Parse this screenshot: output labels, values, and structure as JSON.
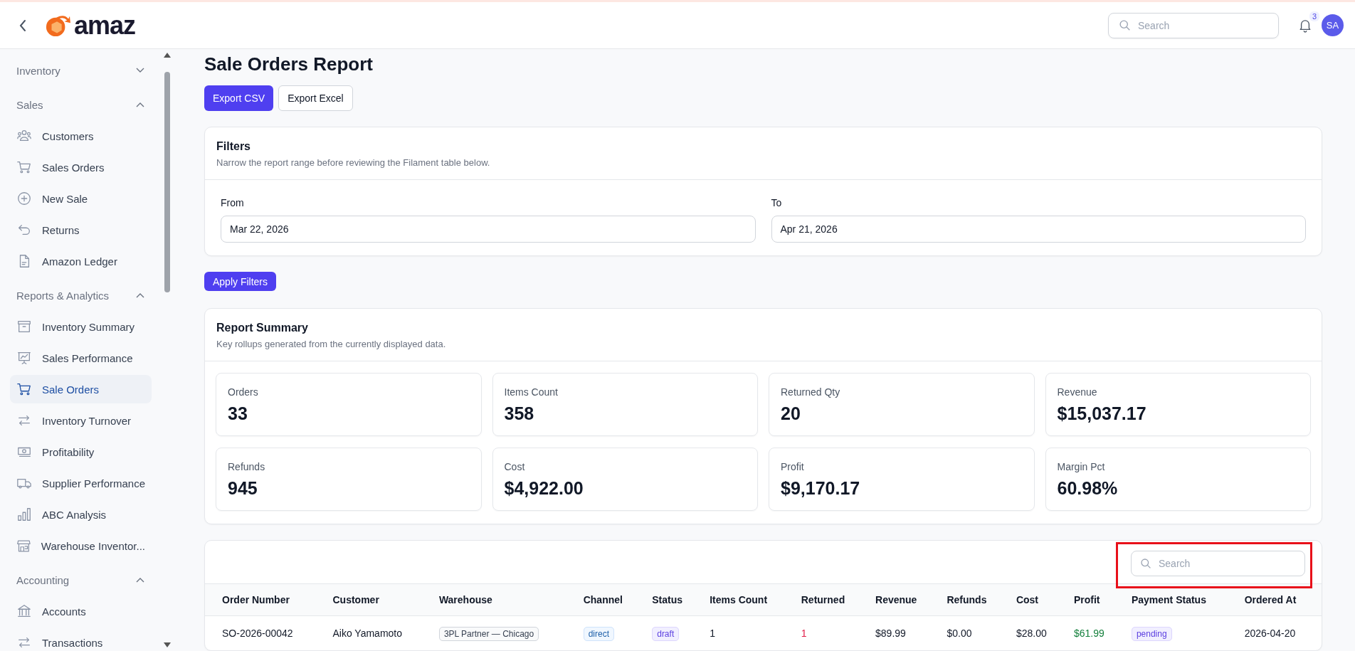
{
  "header": {
    "logo": "amaz",
    "search": {
      "placeholder": "Search"
    },
    "notifications": "3",
    "avatar": "SA"
  },
  "sidebar": {
    "sections": [
      {
        "label": "Inventory",
        "expanded": false
      },
      {
        "label": "Sales",
        "expanded": true,
        "items": [
          {
            "label": "Customers",
            "selected": false
          },
          {
            "label": "Sales Orders",
            "selected": false
          },
          {
            "label": "New Sale",
            "selected": false
          },
          {
            "label": "Returns",
            "selected": false
          },
          {
            "label": "Amazon Ledger",
            "selected": false
          }
        ]
      },
      {
        "label": "Reports & Analytics",
        "expanded": true,
        "items": [
          {
            "label": "Inventory Summary",
            "selected": false
          },
          {
            "label": "Sales Performance",
            "selected": false
          },
          {
            "label": "Sale Orders",
            "selected": true
          },
          {
            "label": "Inventory Turnover",
            "selected": false
          },
          {
            "label": "Profitability",
            "selected": false
          },
          {
            "label": "Supplier Performance",
            "selected": false
          },
          {
            "label": "ABC Analysis",
            "selected": false
          },
          {
            "label": "Warehouse Inventor...",
            "selected": false
          }
        ]
      },
      {
        "label": "Accounting",
        "expanded": true,
        "items": [
          {
            "label": "Accounts",
            "selected": false
          },
          {
            "label": "Transactions",
            "selected": false
          }
        ]
      }
    ]
  },
  "page": {
    "title": "Sale Orders Report",
    "actions": [
      {
        "label": "Export CSV",
        "kind": "primary"
      },
      {
        "label": "Export Excel",
        "kind": "secondary"
      }
    ]
  },
  "filters": {
    "title": "Filters",
    "description": "Narrow the report range before reviewing the Filament table below.",
    "fields": [
      {
        "label": "From",
        "value": "Mar 22, 2026"
      },
      {
        "label": "To",
        "value": "Apr 21, 2026"
      }
    ],
    "apply": "Apply Filters"
  },
  "summary": {
    "title": "Report Summary",
    "description": "Key rollups generated from the currently displayed data.",
    "stats": [
      {
        "label": "Orders",
        "value": "33"
      },
      {
        "label": "Items Count",
        "value": "358"
      },
      {
        "label": "Returned Qty",
        "value": "20"
      },
      {
        "label": "Revenue",
        "value": "$15,037.17"
      },
      {
        "label": "Refunds",
        "value": "945"
      },
      {
        "label": "Cost",
        "value": "$4,922.00"
      },
      {
        "label": "Profit",
        "value": "$9,170.17"
      },
      {
        "label": "Margin Pct",
        "value": "60.98%"
      }
    ]
  },
  "table": {
    "search": {
      "placeholder": "Search"
    },
    "columns": [
      "Order Number",
      "Customer",
      "Warehouse",
      "Channel",
      "Status",
      "Items Count",
      "Returned",
      "Revenue",
      "Refunds",
      "Cost",
      "Profit",
      "Payment Status",
      "Ordered At"
    ],
    "rows": [
      [
        {
          "kind": "text",
          "text": "SO-2026-00042"
        },
        {
          "kind": "text",
          "text": "Aiko Yamamoto"
        },
        {
          "kind": "tag",
          "text": "3PL Partner — Chicago"
        },
        {
          "kind": "info",
          "text": "direct"
        },
        {
          "kind": "accent",
          "text": "draft"
        },
        {
          "kind": "text",
          "text": "1"
        },
        {
          "kind": "danger",
          "text": "1"
        },
        {
          "kind": "text",
          "text": "$89.99"
        },
        {
          "kind": "text",
          "text": "$0.00"
        },
        {
          "kind": "text",
          "text": "$28.00"
        },
        {
          "kind": "success",
          "text": "$61.99"
        },
        {
          "kind": "accent",
          "text": "pending"
        },
        {
          "kind": "text",
          "text": "2026-04-20"
        }
      ]
    ]
  }
}
